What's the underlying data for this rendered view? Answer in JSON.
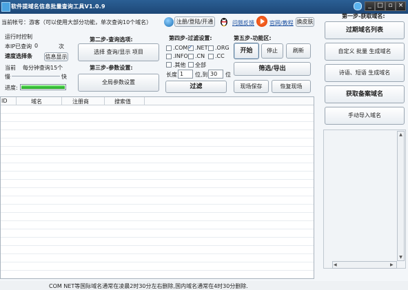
{
  "window": {
    "title": "软件提域名信息批量查询工具V1.0.9"
  },
  "account": {
    "text": "当前帐号：游客（可以使用大部分功能，单次查询10个域名）"
  },
  "header": {
    "register_btn": "注册/登陆/开通",
    "feedback_link": "问题反馈",
    "website_link": "官网/教程",
    "skin_btn": "换皮肤"
  },
  "runtime": {
    "title": "运行时控制",
    "ip_query_label": "本IP已查询",
    "ip_query_count": "0",
    "ip_query_unit": "次",
    "speed_label": "速度选择条",
    "info_btn": "信息显示",
    "current_label": "当前",
    "per_minute_label": "每分钟查询15个",
    "slow_label": "慢",
    "fast_label": "快",
    "progress_label": "进度:",
    "progress_value": 1.0
  },
  "step2": {
    "title": "第二步-查询选项:",
    "btn": "选择 查询/显示 项目"
  },
  "step3": {
    "title": "第三步-参数设置:",
    "btn": "全局参数设置"
  },
  "step4": {
    "title": "第四步-过滤设置:",
    "options": [
      {
        "label": ".COM",
        "checked": false
      },
      {
        "label": ".NET",
        "checked": true
      },
      {
        "label": ".ORG",
        "checked": false
      },
      {
        "label": ".INFO",
        "checked": false
      },
      {
        "label": ".CN",
        "checked": false
      },
      {
        "label": ".CC",
        "checked": false
      },
      {
        "label": ".其他",
        "checked": false
      },
      {
        "label": "全部",
        "checked": false
      }
    ],
    "length_label": "长度",
    "length_min": "1",
    "length_to": "位,到",
    "length_max": "30",
    "length_unit": "位",
    "filter_btn": "过滤"
  },
  "step5": {
    "title": "第五步-功能区:",
    "start_btn": "开始",
    "stop_btn": "停止",
    "refresh_btn": "刷新",
    "export_btn": "筛选/导出",
    "save_btn": "现场保存",
    "restore_btn": "恢复现场"
  },
  "table": {
    "columns": [
      "ID",
      "域名",
      "注册商",
      "搜索值"
    ]
  },
  "right_panel": {
    "title": "第一步-获取域名:",
    "buttons": [
      "过期域名列表",
      "自定义 批量 生成域名",
      "诗语、短语 生成域名",
      "获取备案域名",
      "手动导入域名"
    ]
  },
  "status": {
    "text": "COM NET等国际域名通常在凌晨2时30分左右删除,国内域名通常在4时30分删除."
  },
  "colors": {
    "titlebar": "#1d4777",
    "accent": "#1a4fa0",
    "progress": "#1fa11f"
  }
}
